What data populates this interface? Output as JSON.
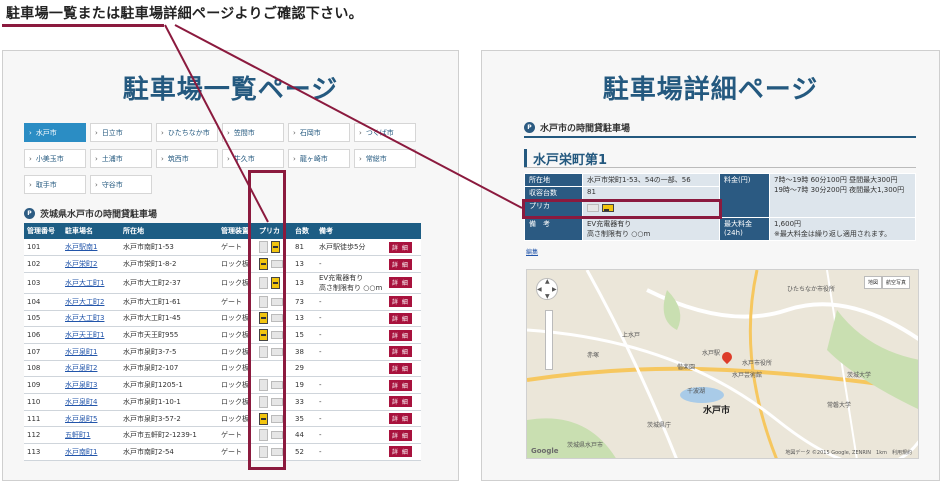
{
  "caption": "駐車場一覧または駐車場詳細ページよりご確認下さい。",
  "left_panel": {
    "heading": "駐車場一覧ページ",
    "cities": [
      "水戸市",
      "日立市",
      "ひたちなか市",
      "笠間市",
      "石岡市",
      "つくば市",
      "小美玉市",
      "土浦市",
      "筑西市",
      "牛久市",
      "龍ヶ崎市",
      "常総市",
      "取手市",
      "守谷市"
    ],
    "active_city": "水戸市",
    "section_title": "茨城県水戸市の時間貸駐車場",
    "table": {
      "headers": [
        "管理番号",
        "駐車場名",
        "所在地",
        "管理装置",
        "プリカ",
        "台数",
        "備考",
        ""
      ],
      "rows": [
        {
          "id": "101",
          "name": "水戸駅南1",
          "address": "水戸市南町1-53",
          "device": "ゲート",
          "count": "81",
          "note": "水戸駅徒歩5分",
          "note2": ""
        },
        {
          "id": "102",
          "name": "水戸栄町2",
          "address": "水戸市栄町1-8-2",
          "device": "ロック板",
          "count": "13",
          "note": "-",
          "note2": ""
        },
        {
          "id": "103",
          "name": "水戸大工町1",
          "address": "水戸市大工町2-37",
          "device": "ロック板",
          "count": "13",
          "note": "EV充電器有り",
          "note2": "高さ制限有り ○○m"
        },
        {
          "id": "104",
          "name": "水戸大工町2",
          "address": "水戸市大工町1-61",
          "device": "ゲート",
          "count": "73",
          "note": "-",
          "note2": ""
        },
        {
          "id": "105",
          "name": "水戸大工町3",
          "address": "水戸市大工町1-45",
          "device": "ロック板",
          "count": "13",
          "note": "-",
          "note2": ""
        },
        {
          "id": "106",
          "name": "水戸天王町1",
          "address": "水戸市天王町955",
          "device": "ロック板",
          "count": "15",
          "note": "-",
          "note2": ""
        },
        {
          "id": "107",
          "name": "水戸泉町1",
          "address": "水戸市泉町3-7-5",
          "device": "ロック板",
          "count": "38",
          "note": "-",
          "note2": ""
        },
        {
          "id": "108",
          "name": "水戸泉町2",
          "address": "水戸市泉町2-107",
          "device": "ロック板",
          "count": "29",
          "note": "",
          "note2": ""
        },
        {
          "id": "109",
          "name": "水戸泉町3",
          "address": "水戸市泉町1205-1",
          "device": "ロック板",
          "count": "19",
          "note": "-",
          "note2": ""
        },
        {
          "id": "110",
          "name": "水戸泉町4",
          "address": "水戸市泉町1-10-1",
          "device": "ロック板",
          "count": "33",
          "note": "-",
          "note2": ""
        },
        {
          "id": "111",
          "name": "水戸泉町5",
          "address": "水戸市泉町3-57-2",
          "device": "ロック板",
          "count": "35",
          "note": "-",
          "note2": ""
        },
        {
          "id": "112",
          "name": "五軒町1",
          "address": "水戸市五軒町2-1239-1",
          "device": "ゲート",
          "count": "44",
          "note": "-",
          "note2": ""
        },
        {
          "id": "113",
          "name": "水戸南町1",
          "address": "水戸市南町2-54",
          "device": "ゲート",
          "count": "52",
          "note": "-",
          "note2": ""
        }
      ],
      "detail_label": "詳 細"
    }
  },
  "right_panel": {
    "heading": "駐車場詳細ページ",
    "section_title": "水戸市の時間貸駐車場",
    "lot_name": "水戸栄町第1",
    "details": {
      "address_label": "所在地",
      "address": "水戸市栄町1-53、54の一部、56",
      "capacity_label": "収容台数",
      "capacity": "81",
      "prica_label": "プリカ",
      "remarks_label": "備　考",
      "remarks1": "EV充電器有り",
      "remarks2": "高さ制限有り ○○m",
      "fee_label": "料金(円)",
      "fee1": "7時〜19時 60分100円 昼間最大300円",
      "fee2": "19時〜7時 30分200円 夜間最大1,300円",
      "max_fee_label": "最大料金(24h)",
      "max_fee": "1,600円",
      "max_fee_note": "※最大料金は繰り返し適用されます。"
    },
    "edit_link": "編集",
    "map": {
      "city_label": "水戸市",
      "labels": [
        "ひたちなか市役所",
        "水戸駅",
        "茨城県庁",
        "偕楽園",
        "千波湖",
        "水戸芸術館",
        "水戸市役所",
        "茨城県水戸市",
        "上水戸",
        "赤塚",
        "常磐大学",
        "茨城大学"
      ],
      "map_type": [
        "地図",
        "航空写真"
      ],
      "logo": "Google",
      "footer": "地図データ ©2015 Google, ZENRIN　1km　利用規約"
    }
  }
}
